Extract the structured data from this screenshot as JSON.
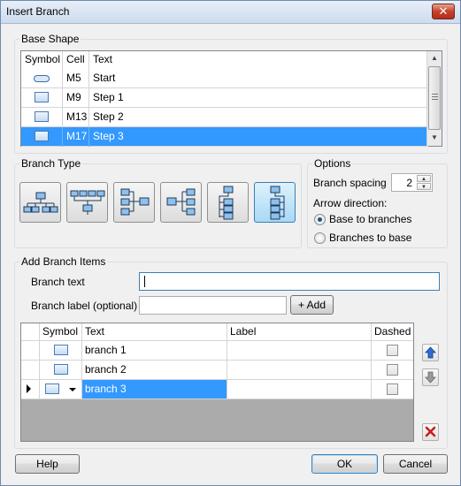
{
  "window": {
    "title": "Insert Branch",
    "close_label": "✕"
  },
  "base_shape": {
    "group_label": "Base Shape",
    "columns": [
      "Symbol",
      "Cell",
      "Text"
    ],
    "rows": [
      {
        "symbol": "oval-icon",
        "cell": "M5",
        "text": "Start",
        "selected": false
      },
      {
        "symbol": "rect-icon",
        "cell": "M9",
        "text": "Step 1",
        "selected": false
      },
      {
        "symbol": "rect-icon",
        "cell": "M13",
        "text": "Step 2",
        "selected": false
      },
      {
        "symbol": "rect-icon",
        "cell": "M17",
        "text": "Step 3",
        "selected": true
      }
    ]
  },
  "branch_type": {
    "group_label": "Branch Type",
    "options": [
      {
        "icon": "branch-down-icon",
        "active": false
      },
      {
        "icon": "branch-up-down-icon",
        "active": false
      },
      {
        "icon": "branch-right-icon",
        "active": false
      },
      {
        "icon": "branch-left-icon",
        "active": false
      },
      {
        "icon": "branch-vertical-left-icon",
        "active": false
      },
      {
        "icon": "branch-vertical-right-icon",
        "active": true
      }
    ]
  },
  "options": {
    "group_label": "Options",
    "spacing_label": "Branch spacing",
    "spacing_value": "2",
    "arrow_label": "Arrow direction:",
    "radio_base": "Base to branches",
    "radio_branches": "Branches to base",
    "selected_radio": "Base to branches"
  },
  "add_items": {
    "group_label": "Add Branch Items",
    "branch_text_label": "Branch text",
    "branch_text_value": "",
    "branch_label_label": "Branch label (optional)",
    "branch_label_value": "",
    "add_button": "+ Add",
    "columns": [
      "Symbol",
      "Text",
      "Label",
      "Dashed"
    ],
    "rows": [
      {
        "symbol": "rect-icon",
        "text": "branch 1",
        "label": "",
        "dashed": false,
        "current": false
      },
      {
        "symbol": "rect-icon",
        "text": "branch 2",
        "label": "",
        "dashed": false,
        "current": false
      },
      {
        "symbol": "rect-icon",
        "text": "branch 3",
        "label": "",
        "dashed": false,
        "current": true
      }
    ]
  },
  "footer": {
    "help": "Help",
    "ok": "OK",
    "cancel": "Cancel"
  },
  "colors": {
    "selection": "#3399ff",
    "titlebar": "#cddcef",
    "dialog_bg": "#f0f0f0"
  }
}
